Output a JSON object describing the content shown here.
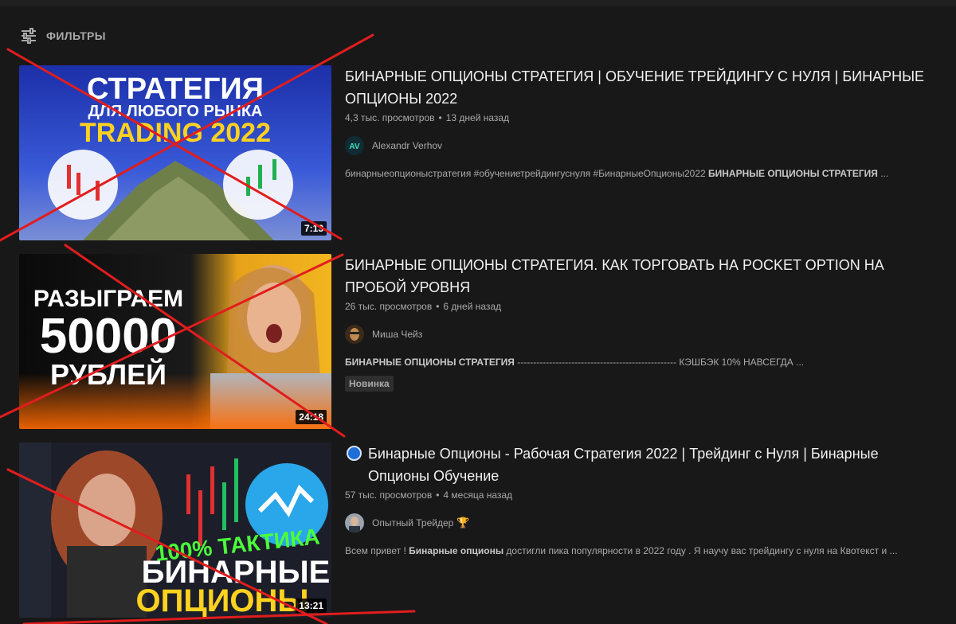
{
  "filters": {
    "label": "ФИЛЬТРЫ",
    "icon": "sliders-icon"
  },
  "videos": [
    {
      "title": "БИНАРНЫЕ ОПЦИОНЫ СТРАТЕГИЯ | ОБУЧЕНИЕ ТРЕЙДИНГУ С НУЛЯ | БИНАРНЫЕ ОПЦИОНЫ 2022",
      "views": "4,3 тыс. просмотров",
      "age": "13 дней назад",
      "channel": "Alexandr Verhov",
      "avatar_text": "AV",
      "description_plain": "бинарныеопционыстратегия #обучениетрейдингуснуля #БинарныеОпционы2022 ",
      "description_bold": "БИНАРНЫЕ ОПЦИОНЫ СТРАТЕГИЯ",
      "description_tail": " ...",
      "duration": "7:13",
      "thumb_text": {
        "line1": "СТРАТЕГИЯ",
        "line2": "ДЛЯ ЛЮБОГО РЫНКА",
        "line3": "TRADING 2022"
      }
    },
    {
      "title": "БИНАРНЫЕ ОПЦИОНЫ СТРАТЕГИЯ. КАК ТОРГОВАТЬ НА POCKET OPTION НА ПРОБОЙ УРОВНЯ",
      "views": "26 тыс. просмотров",
      "age": "6 дней назад",
      "channel": "Миша Чейз",
      "description_bold": "БИНАРНЫЕ ОПЦИОНЫ СТРАТЕГИЯ",
      "description_tail": " -------------------------------------------------- КЭШБЭК 10% НАВСЕГДА ...",
      "badge": "Новинка",
      "duration": "24:18",
      "thumb_text": {
        "line1": "РАЗЫГРАЕМ",
        "line2": "50000",
        "line3": "РУБЛЕЙ"
      }
    },
    {
      "title": "Бинарные Опционы - Рабочая Стратегия 2022 | Трейдинг с Нуля | Бинарные Опционы Обучение",
      "views": "57 тыс. просмотров",
      "age": "4 месяца назад",
      "channel": "Опытный Трейдер",
      "channel_suffix": "🏆",
      "description_plain": "Всем привет ! ",
      "description_bold": "Бинарные опционы",
      "description_tail": " достигли пика популярности в 2022 году . Я научу вас трейдингу с нуля на Квотекст и ...",
      "duration": "13:21",
      "thumb_text": {
        "line1": "100% ТАКТИКА",
        "line2": "БИНАРНЫЕ",
        "line3": "ОПЦИОНЫ"
      }
    }
  ],
  "colors": {
    "background": "#181818",
    "text": "#f1f1f1",
    "secondary": "#aaaaaa",
    "cross": "#e11d1d"
  }
}
